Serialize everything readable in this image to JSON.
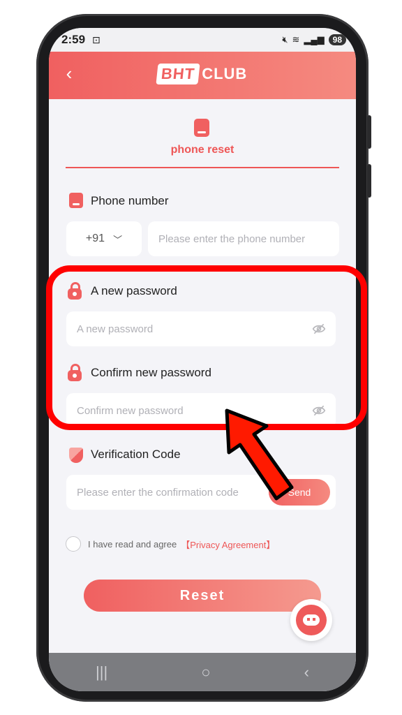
{
  "status_bar": {
    "time": "2:59",
    "battery": "98"
  },
  "header": {
    "logo_box": "BHT",
    "logo_text": "CLUB"
  },
  "tab": {
    "label": "phone reset"
  },
  "phone_section": {
    "label": "Phone number",
    "country_code": "+91",
    "placeholder": "Please enter the phone number"
  },
  "new_password": {
    "label": "A new password",
    "placeholder": "A new password"
  },
  "confirm_password": {
    "label": "Confirm new password",
    "placeholder": "Confirm new password"
  },
  "verification": {
    "label": "Verification Code",
    "placeholder": "Please enter the confirmation code",
    "send_label": "Send"
  },
  "agreement": {
    "text": "I have read and agree",
    "link": "【Privacy Agreement】"
  },
  "reset_label": "Reset",
  "colors": {
    "accent": "#f06060",
    "annotation": "#ff0000"
  },
  "icons": [
    "back-icon",
    "phone-icon",
    "lock-icon",
    "shield-icon",
    "eye-off-icon",
    "chevron-down-icon",
    "chat-icon"
  ]
}
